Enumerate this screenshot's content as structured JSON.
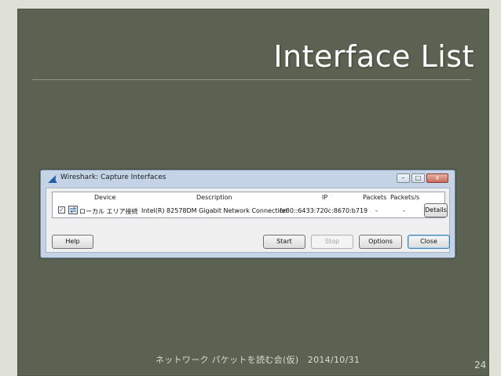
{
  "slide": {
    "title": "Interface List",
    "footer": "ネットワーク パケットを読む会(仮)　2014/10/31",
    "page_number": "24",
    "colors": {
      "panel": "#5c6252",
      "title": "#ffffff"
    }
  },
  "window": {
    "title": "Wireshark: Capture Interfaces",
    "icon": "wireshark-fin-icon",
    "controls": {
      "minimize": "–",
      "maximize": "□",
      "close": "x"
    },
    "table": {
      "headers": [
        "Device",
        "Description",
        "IP",
        "Packets",
        "Packets/s"
      ],
      "rows": [
        {
          "checked": true,
          "icon": "network-adapter-icon",
          "device": "ローカル エリア接続",
          "description": "Intel(R) 82578DM Gigabit Network Connection",
          "ip": "fe80::6433:720c:8670:b719",
          "packets": "-",
          "packets_per_sec": "-",
          "details_label": "Details"
        }
      ]
    },
    "buttons": {
      "help": "Help",
      "start": "Start",
      "stop": "Stop",
      "options": "Options",
      "close": "Close"
    }
  }
}
